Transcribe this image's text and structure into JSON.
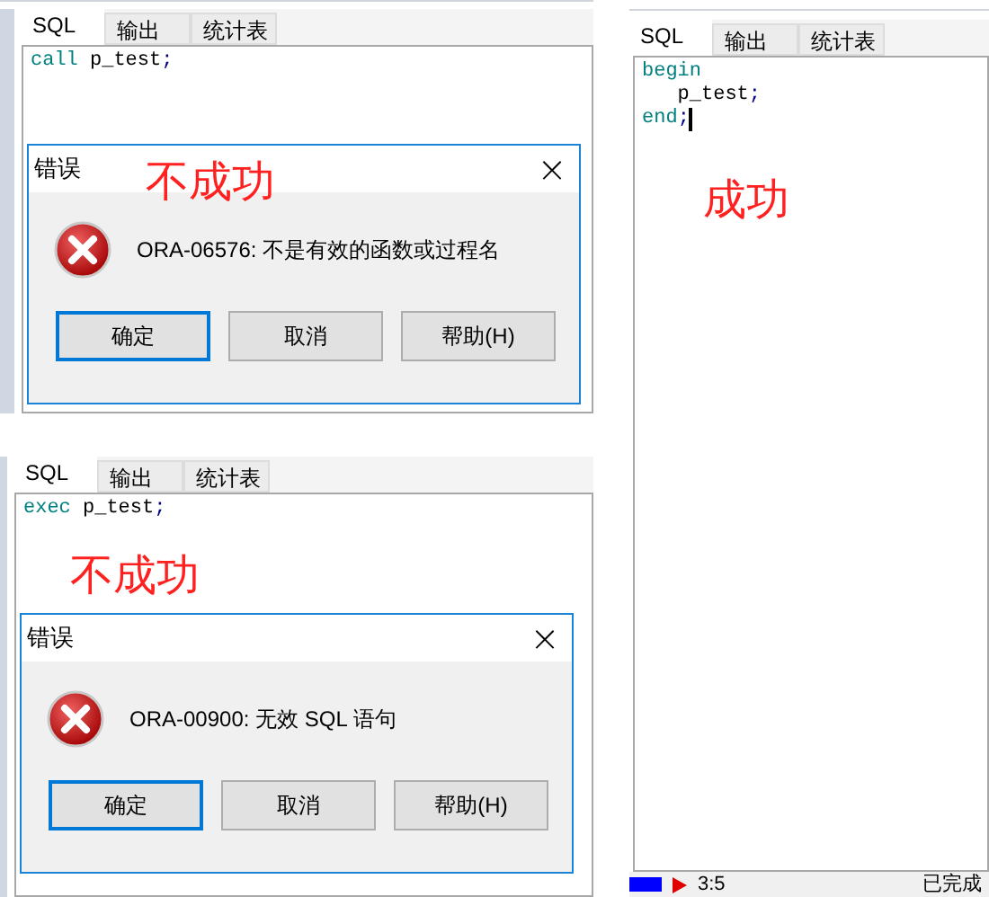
{
  "panels": [
    {
      "tabs": [
        {
          "label": "SQL",
          "selected": true
        },
        {
          "label": "输出",
          "selected": false
        },
        {
          "label": "统计表",
          "selected": false
        }
      ],
      "code": [
        {
          "tokens": [
            {
              "kind": "keyword",
              "text": "call"
            },
            {
              "kind": "plain",
              "text": " p_test"
            },
            {
              "kind": "punct",
              "text": ";"
            }
          ],
          "cursor": false
        }
      ],
      "annotation": {
        "text": "不成功"
      },
      "dialog": {
        "title": "错误",
        "close": "×",
        "message": "ORA-06576: 不是有效的函数或过程名",
        "buttons": [
          {
            "label": "确定",
            "default": true
          },
          {
            "label": "取消",
            "default": false
          },
          {
            "label": "帮助(H)",
            "default": false
          }
        ]
      }
    },
    {
      "tabs": [
        {
          "label": "SQL",
          "selected": true
        },
        {
          "label": "输出",
          "selected": false
        },
        {
          "label": "统计表",
          "selected": false
        }
      ],
      "code": [
        {
          "tokens": [
            {
              "kind": "keyword",
              "text": "exec"
            },
            {
              "kind": "plain",
              "text": " p_test"
            },
            {
              "kind": "punct",
              "text": ";"
            }
          ],
          "cursor": false
        }
      ],
      "annotation": {
        "text": "不成功"
      },
      "dialog": {
        "title": "错误",
        "close": "×",
        "message": "ORA-00900: 无效 SQL 语句",
        "buttons": [
          {
            "label": "确定",
            "default": true
          },
          {
            "label": "取消",
            "default": false
          },
          {
            "label": "帮助(H)",
            "default": false
          }
        ]
      }
    },
    {
      "tabs": [
        {
          "label": "SQL",
          "selected": true
        },
        {
          "label": "输出",
          "selected": false
        },
        {
          "label": "统计表",
          "selected": false
        }
      ],
      "code": [
        {
          "tokens": [
            {
              "kind": "keyword",
              "text": "begin"
            }
          ],
          "cursor": false
        },
        {
          "tokens": [
            {
              "kind": "plain",
              "text": "   p_test"
            },
            {
              "kind": "punct",
              "text": ";"
            }
          ],
          "cursor": false
        },
        {
          "tokens": [
            {
              "kind": "keyword",
              "text": "end"
            },
            {
              "kind": "punct",
              "text": ";"
            }
          ],
          "cursor": true
        }
      ],
      "annotation": {
        "text": "成功"
      },
      "status_bar": {
        "position": "3:5",
        "status": "已完成"
      }
    }
  ]
}
